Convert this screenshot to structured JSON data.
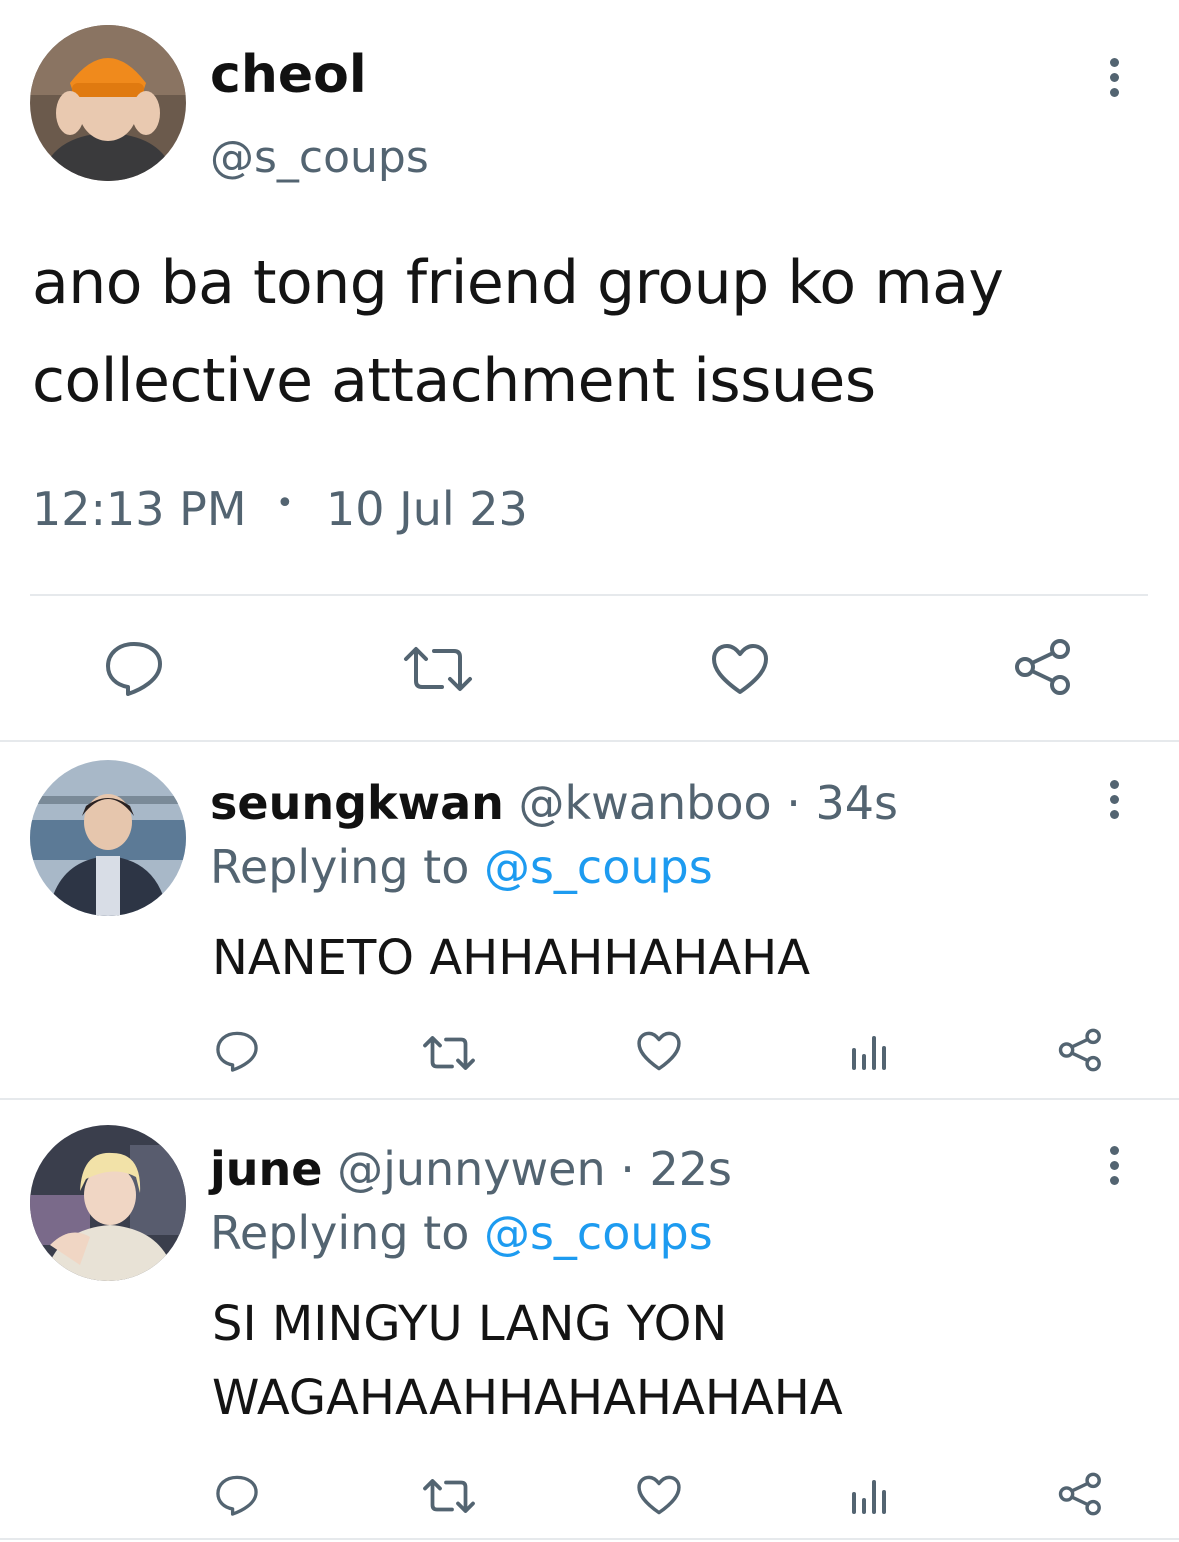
{
  "main_tweet": {
    "display_name": "cheol",
    "handle": "@s_coups",
    "text_line1": "ano ba tong friend group ko may",
    "text_line2": "collective attachment issues",
    "time": "12:13 PM",
    "separator": "•",
    "date": "10 Jul 23",
    "avatar_icon": "user-avatar-orange-beanie"
  },
  "replies": [
    {
      "display_name": "seungkwan",
      "handle": "@kwanboo",
      "age": "· 34s",
      "replying_label": "Replying to",
      "replying_to": "@s_coups",
      "text_line1": "NANETO AHHAHHAHAHA",
      "avatar_icon": "user-avatar-riverside"
    },
    {
      "display_name": "june",
      "handle": "@junnywen",
      "age": "· 22s",
      "replying_label": "Replying to",
      "replying_to": "@s_coups",
      "text_line1": "SI MINGYU LANG YON",
      "text_line2": "WAGAHAAHHAHAHAHAHA",
      "avatar_icon": "user-avatar-blond"
    }
  ],
  "colors": {
    "text": "#111111",
    "secondary": "#536471",
    "link": "#1d9bf0",
    "divider": "#e6e9ec"
  }
}
